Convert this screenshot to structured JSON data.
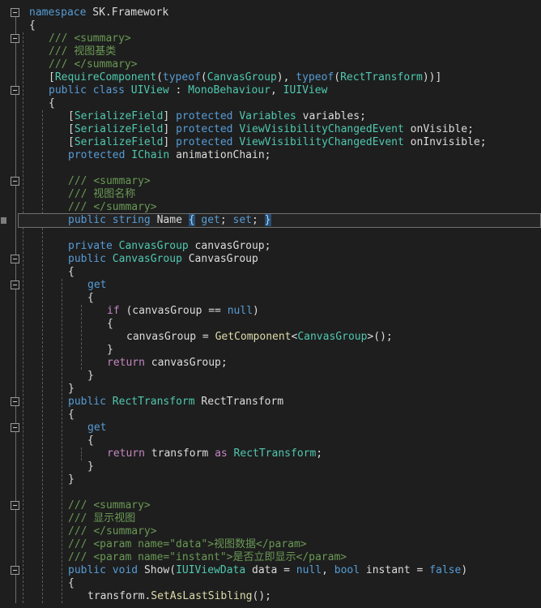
{
  "editor": {
    "language": "csharp",
    "theme": "dark",
    "background_color": "#1e1e1e",
    "foreground_color": "#dcdcdc",
    "current_line": 17,
    "font_size_px": 13,
    "line_height_px": 16,
    "colors": {
      "keyword": "#569cd6",
      "control_keyword": "#c586c0",
      "type": "#4ec9b0",
      "comment": "#6a9955",
      "method": "#dcdcaa",
      "plain": "#dcdcdc",
      "brace_match_background": "#264f78",
      "current_line_border": "#707070",
      "indent_guide": "#5a5a5a",
      "fold_marker": "#9a9a9a"
    }
  },
  "code_lines": [
    {
      "n": 1,
      "indent": 0,
      "tokens": [
        {
          "t": "namespace ",
          "c": "kw"
        },
        {
          "t": "SK.Framework",
          "c": "txt"
        }
      ]
    },
    {
      "n": 2,
      "indent": 0,
      "tokens": [
        {
          "t": "{",
          "c": "txt"
        }
      ]
    },
    {
      "n": 3,
      "indent": 1,
      "tokens": [
        {
          "t": "/// ",
          "c": "cmt"
        },
        {
          "t": "<summary>",
          "c": "xml"
        }
      ]
    },
    {
      "n": 4,
      "indent": 1,
      "tokens": [
        {
          "t": "/// 视图基类",
          "c": "cmt"
        }
      ]
    },
    {
      "n": 5,
      "indent": 1,
      "tokens": [
        {
          "t": "/// ",
          "c": "cmt"
        },
        {
          "t": "</summary>",
          "c": "xml"
        }
      ]
    },
    {
      "n": 6,
      "indent": 1,
      "tokens": [
        {
          "t": "[",
          "c": "txt"
        },
        {
          "t": "RequireComponent",
          "c": "type"
        },
        {
          "t": "(",
          "c": "txt"
        },
        {
          "t": "typeof",
          "c": "kw"
        },
        {
          "t": "(",
          "c": "txt"
        },
        {
          "t": "CanvasGroup",
          "c": "type"
        },
        {
          "t": "), ",
          "c": "txt"
        },
        {
          "t": "typeof",
          "c": "kw"
        },
        {
          "t": "(",
          "c": "txt"
        },
        {
          "t": "RectTransform",
          "c": "type"
        },
        {
          "t": "))]",
          "c": "txt"
        }
      ]
    },
    {
      "n": 7,
      "indent": 1,
      "tokens": [
        {
          "t": "public ",
          "c": "kw"
        },
        {
          "t": "class ",
          "c": "kw"
        },
        {
          "t": "UIView",
          "c": "type"
        },
        {
          "t": " : ",
          "c": "txt"
        },
        {
          "t": "MonoBehaviour",
          "c": "type"
        },
        {
          "t": ", ",
          "c": "txt"
        },
        {
          "t": "IUIView",
          "c": "type"
        }
      ]
    },
    {
      "n": 8,
      "indent": 1,
      "tokens": [
        {
          "t": "{",
          "c": "txt"
        }
      ]
    },
    {
      "n": 9,
      "indent": 2,
      "tokens": [
        {
          "t": "[",
          "c": "txt"
        },
        {
          "t": "SerializeField",
          "c": "type"
        },
        {
          "t": "] ",
          "c": "txt"
        },
        {
          "t": "protected ",
          "c": "kw"
        },
        {
          "t": "Variables",
          "c": "type"
        },
        {
          "t": " variables;",
          "c": "txt"
        }
      ]
    },
    {
      "n": 10,
      "indent": 2,
      "tokens": [
        {
          "t": "[",
          "c": "txt"
        },
        {
          "t": "SerializeField",
          "c": "type"
        },
        {
          "t": "] ",
          "c": "txt"
        },
        {
          "t": "protected ",
          "c": "kw"
        },
        {
          "t": "ViewVisibilityChangedEvent",
          "c": "type"
        },
        {
          "t": " onVisible;",
          "c": "txt"
        }
      ]
    },
    {
      "n": 11,
      "indent": 2,
      "tokens": [
        {
          "t": "[",
          "c": "txt"
        },
        {
          "t": "SerializeField",
          "c": "type"
        },
        {
          "t": "] ",
          "c": "txt"
        },
        {
          "t": "protected ",
          "c": "kw"
        },
        {
          "t": "ViewVisibilityChangedEvent",
          "c": "type"
        },
        {
          "t": " onInvisible;",
          "c": "txt"
        }
      ]
    },
    {
      "n": 12,
      "indent": 2,
      "tokens": [
        {
          "t": "protected ",
          "c": "kw"
        },
        {
          "t": "IChain",
          "c": "type"
        },
        {
          "t": " animationChain;",
          "c": "txt"
        }
      ]
    },
    {
      "n": 13,
      "indent": 2,
      "tokens": []
    },
    {
      "n": 14,
      "indent": 2,
      "tokens": [
        {
          "t": "/// ",
          "c": "cmt"
        },
        {
          "t": "<summary>",
          "c": "xml"
        }
      ]
    },
    {
      "n": 15,
      "indent": 2,
      "tokens": [
        {
          "t": "/// 视图名称",
          "c": "cmt"
        }
      ]
    },
    {
      "n": 16,
      "indent": 2,
      "tokens": [
        {
          "t": "/// ",
          "c": "cmt"
        },
        {
          "t": "</summary>",
          "c": "xml"
        }
      ]
    },
    {
      "n": 17,
      "indent": 2,
      "current": true,
      "tokens": [
        {
          "t": "public ",
          "c": "kw"
        },
        {
          "t": "string ",
          "c": "kw"
        },
        {
          "t": "Name ",
          "c": "txt"
        },
        {
          "t": "{",
          "c": "brace-hl"
        },
        {
          "t": " ",
          "c": "txt"
        },
        {
          "t": "get",
          "c": "kw"
        },
        {
          "t": "; ",
          "c": "txt"
        },
        {
          "t": "set",
          "c": "kw"
        },
        {
          "t": "; ",
          "c": "txt"
        },
        {
          "t": "}",
          "c": "brace-hl"
        }
      ]
    },
    {
      "n": 18,
      "indent": 2,
      "tokens": []
    },
    {
      "n": 19,
      "indent": 2,
      "tokens": [
        {
          "t": "private ",
          "c": "kw"
        },
        {
          "t": "CanvasGroup",
          "c": "type"
        },
        {
          "t": " canvasGroup;",
          "c": "txt"
        }
      ]
    },
    {
      "n": 20,
      "indent": 2,
      "tokens": [
        {
          "t": "public ",
          "c": "kw"
        },
        {
          "t": "CanvasGroup",
          "c": "type"
        },
        {
          "t": " CanvasGroup",
          "c": "txt"
        }
      ]
    },
    {
      "n": 21,
      "indent": 2,
      "tokens": [
        {
          "t": "{",
          "c": "txt"
        }
      ]
    },
    {
      "n": 22,
      "indent": 3,
      "tokens": [
        {
          "t": "get",
          "c": "kw"
        }
      ]
    },
    {
      "n": 23,
      "indent": 3,
      "tokens": [
        {
          "t": "{",
          "c": "txt"
        }
      ]
    },
    {
      "n": 24,
      "indent": 4,
      "tokens": [
        {
          "t": "if",
          "c": "ctl"
        },
        {
          "t": " (canvasGroup == ",
          "c": "txt"
        },
        {
          "t": "null",
          "c": "kw"
        },
        {
          "t": ")",
          "c": "txt"
        }
      ]
    },
    {
      "n": 25,
      "indent": 4,
      "tokens": [
        {
          "t": "{",
          "c": "txt"
        }
      ]
    },
    {
      "n": 26,
      "indent": 5,
      "tokens": [
        {
          "t": "canvasGroup = ",
          "c": "txt"
        },
        {
          "t": "GetComponent",
          "c": "fn"
        },
        {
          "t": "<",
          "c": "txt"
        },
        {
          "t": "CanvasGroup",
          "c": "type"
        },
        {
          "t": ">();",
          "c": "txt"
        }
      ]
    },
    {
      "n": 27,
      "indent": 4,
      "tokens": [
        {
          "t": "}",
          "c": "txt"
        }
      ]
    },
    {
      "n": 28,
      "indent": 4,
      "tokens": [
        {
          "t": "return",
          "c": "ctl"
        },
        {
          "t": " canvasGroup;",
          "c": "txt"
        }
      ]
    },
    {
      "n": 29,
      "indent": 3,
      "tokens": [
        {
          "t": "}",
          "c": "txt"
        }
      ]
    },
    {
      "n": 30,
      "indent": 2,
      "tokens": [
        {
          "t": "}",
          "c": "txt"
        }
      ]
    },
    {
      "n": 31,
      "indent": 2,
      "tokens": [
        {
          "t": "public ",
          "c": "kw"
        },
        {
          "t": "RectTransform",
          "c": "type"
        },
        {
          "t": " RectTransform",
          "c": "txt"
        }
      ]
    },
    {
      "n": 32,
      "indent": 2,
      "tokens": [
        {
          "t": "{",
          "c": "txt"
        }
      ]
    },
    {
      "n": 33,
      "indent": 3,
      "tokens": [
        {
          "t": "get",
          "c": "kw"
        }
      ]
    },
    {
      "n": 34,
      "indent": 3,
      "tokens": [
        {
          "t": "{",
          "c": "txt"
        }
      ]
    },
    {
      "n": 35,
      "indent": 4,
      "tokens": [
        {
          "t": "return",
          "c": "ctl"
        },
        {
          "t": " transform ",
          "c": "txt"
        },
        {
          "t": "as",
          "c": "ctl"
        },
        {
          "t": " ",
          "c": "txt"
        },
        {
          "t": "RectTransform",
          "c": "type"
        },
        {
          "t": ";",
          "c": "txt"
        }
      ]
    },
    {
      "n": 36,
      "indent": 3,
      "tokens": [
        {
          "t": "}",
          "c": "txt"
        }
      ]
    },
    {
      "n": 37,
      "indent": 2,
      "tokens": [
        {
          "t": "}",
          "c": "txt"
        }
      ]
    },
    {
      "n": 38,
      "indent": 2,
      "tokens": []
    },
    {
      "n": 39,
      "indent": 2,
      "tokens": [
        {
          "t": "/// ",
          "c": "cmt"
        },
        {
          "t": "<summary>",
          "c": "xml"
        }
      ]
    },
    {
      "n": 40,
      "indent": 2,
      "tokens": [
        {
          "t": "/// 显示视图",
          "c": "cmt"
        }
      ]
    },
    {
      "n": 41,
      "indent": 2,
      "tokens": [
        {
          "t": "/// ",
          "c": "cmt"
        },
        {
          "t": "</summary>",
          "c": "xml"
        }
      ]
    },
    {
      "n": 42,
      "indent": 2,
      "tokens": [
        {
          "t": "/// ",
          "c": "cmt"
        },
        {
          "t": "<param name=\"data\">视图数据</param>",
          "c": "xml"
        }
      ]
    },
    {
      "n": 43,
      "indent": 2,
      "tokens": [
        {
          "t": "/// ",
          "c": "cmt"
        },
        {
          "t": "<param name=\"instant\">是否立即显示</param>",
          "c": "xml"
        }
      ]
    },
    {
      "n": 44,
      "indent": 2,
      "tokens": [
        {
          "t": "public ",
          "c": "kw"
        },
        {
          "t": "void ",
          "c": "kw"
        },
        {
          "t": "Show",
          "c": "txt"
        },
        {
          "t": "(",
          "c": "txt"
        },
        {
          "t": "IUIViewData",
          "c": "type"
        },
        {
          "t": " data = ",
          "c": "txt"
        },
        {
          "t": "null",
          "c": "kw"
        },
        {
          "t": ", ",
          "c": "txt"
        },
        {
          "t": "bool",
          "c": "kw"
        },
        {
          "t": " instant = ",
          "c": "txt"
        },
        {
          "t": "false",
          "c": "kw"
        },
        {
          "t": ")",
          "c": "txt"
        }
      ]
    },
    {
      "n": 45,
      "indent": 2,
      "tokens": [
        {
          "t": "{",
          "c": "txt"
        }
      ]
    },
    {
      "n": 46,
      "indent": 3,
      "tokens": [
        {
          "t": "transform.",
          "c": "txt"
        },
        {
          "t": "SetAsLastSibling",
          "c": "fn"
        },
        {
          "t": "();",
          "c": "txt"
        }
      ]
    }
  ],
  "fold_markers": [
    {
      "name": "fold-namespace",
      "line": 1
    },
    {
      "name": "fold-summary-1",
      "line": 3
    },
    {
      "name": "fold-class",
      "line": 7
    },
    {
      "name": "fold-summary-2",
      "line": 14
    },
    {
      "name": "fold-property-cg",
      "line": 20
    },
    {
      "name": "fold-get-cg",
      "line": 22
    },
    {
      "name": "fold-property-rt",
      "line": 31
    },
    {
      "name": "fold-get-rt",
      "line": 33
    },
    {
      "name": "fold-summary-3",
      "line": 39
    },
    {
      "name": "fold-method-show",
      "line": 44
    }
  ],
  "fold_rails": [
    {
      "name": "rail-namespace",
      "from_line": 1,
      "to_line": 46
    },
    {
      "name": "rail-summary-1",
      "from_line": 3,
      "to_line": 5
    },
    {
      "name": "rail-class",
      "from_line": 7,
      "to_line": 46
    },
    {
      "name": "rail-summary-2",
      "from_line": 14,
      "to_line": 16
    },
    {
      "name": "rail-prop-cg",
      "from_line": 20,
      "to_line": 30
    },
    {
      "name": "rail-get-cg",
      "from_line": 22,
      "to_line": 29
    },
    {
      "name": "rail-prop-rt",
      "from_line": 31,
      "to_line": 37
    },
    {
      "name": "rail-get-rt",
      "from_line": 33,
      "to_line": 36
    },
    {
      "name": "rail-summary-3",
      "from_line": 39,
      "to_line": 43
    },
    {
      "name": "rail-show",
      "from_line": 44,
      "to_line": 46
    }
  ],
  "indent_guides": [
    {
      "level": 1,
      "from_line": 3,
      "to_line": 46
    },
    {
      "level": 2,
      "from_line": 9,
      "to_line": 46
    },
    {
      "level": 3,
      "from_line": 22,
      "to_line": 46
    },
    {
      "level": 4,
      "from_line": 24,
      "to_line": 28
    },
    {
      "level": 4,
      "from_line": 35,
      "to_line": 35
    }
  ],
  "glyph_markers": [
    {
      "name": "changed-line-marker",
      "line": 17
    }
  ]
}
